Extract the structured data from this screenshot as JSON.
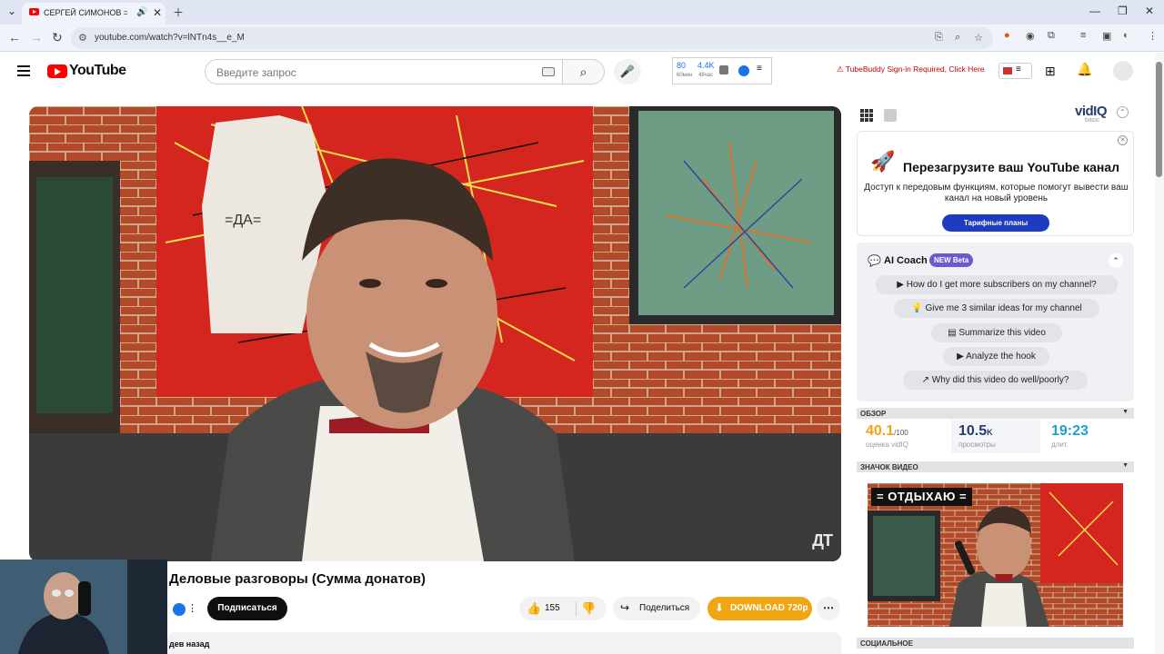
{
  "browser": {
    "tab_title": "СЕРГЕЙ СИМОНОВ == Де",
    "url": "youtube.com/watch?v=lNTn4s__e_M"
  },
  "youtube": {
    "logo_text": "YouTube",
    "search_placeholder": "Введите запрос",
    "tubebuddy_stats": {
      "v1": "80",
      "v1_sub": "60мин",
      "v2": "4.4K",
      "v2_sub": "48час"
    },
    "tubebuddy_warning": "TubeBuddy Sign-in Required, Click Here"
  },
  "video": {
    "watermark": "ДТ",
    "title": "Деловые разговоры (Сумма донатов)",
    "subscribe_label": "Подписаться",
    "likes": "155",
    "share_label": "Поделиться",
    "download_label": "DOWNLOAD 720p",
    "description_snippet": "дев назад"
  },
  "vidiq": {
    "logo": "vidIQ",
    "logo_sub": "basic",
    "promo": {
      "heading": "Перезагрузите ваш YouTube канал",
      "body": "Доступ к передовым функциям, которые помогут вывести ваш канал на новый уровень",
      "cta": "Тарифные планы"
    },
    "coach": {
      "title": "AI Coach",
      "badge": "NEW Beta",
      "prompts": [
        "How do I get more subscribers on my channel?",
        "Give me 3 similar ideas for my channel",
        "Summarize this video",
        "Analyze the hook",
        "Why did this video do well/poorly?"
      ]
    },
    "overview": {
      "header": "ОБЗОР",
      "score": "40.1",
      "score_of": "/100",
      "score_label": "оценка vidIQ",
      "views": "10.5",
      "views_unit": "K",
      "views_label": "просмотры",
      "duration": "19:23",
      "duration_label": "длит."
    },
    "thumbnail_header": "ЗНАЧОК ВИДЕО",
    "thumbnail_caption": "= ОТДЫХАЮ =",
    "social_header": "СОЦИАЛЬНОЕ"
  },
  "colors": {
    "brand_red": "#ff0000",
    "vidiq_blue": "#1d3cbf",
    "score_color": "#f0a513",
    "views_color": "#2a3b6e",
    "duration_color": "#1aa3c8",
    "download_orange": "#f0a513"
  }
}
